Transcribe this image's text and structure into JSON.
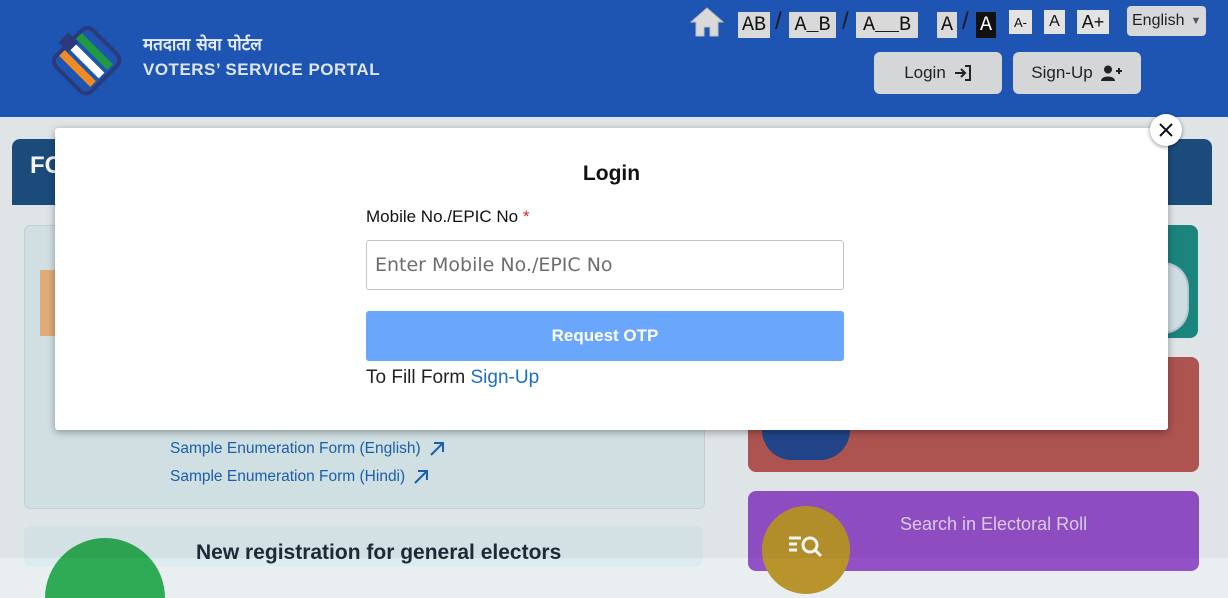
{
  "header": {
    "brand_hindi": "मतदाता सेवा पोर्टल",
    "brand_english": "VOTERS’ SERVICE PORTAL",
    "home_icon": "home-icon",
    "spacing_options": [
      "AB",
      "A_B",
      "A__B"
    ],
    "contrast_options": [
      "A",
      "A"
    ],
    "font_size_options": [
      "A-",
      "A",
      "A+"
    ],
    "language": {
      "selected": "English"
    },
    "login_label": "Login",
    "signup_label": "Sign-Up"
  },
  "background": {
    "section_title_partial": "FC",
    "links": [
      "Sample Enumeration Form (English)",
      "Sample Enumeration Form (Hindi)"
    ],
    "section_heading_partial": "New registration for general electors",
    "red_card_text_partial": "...",
    "purple_card_title": "Search in Electoral Roll",
    "purple_card_subtitle_partial": "..."
  },
  "modal": {
    "title": "Login",
    "field_label": "Mobile No./EPIC No",
    "required_mark": "*",
    "input_placeholder": "Enter Mobile No./EPIC No",
    "input_value": "",
    "submit_label": "Request OTP",
    "footer_text": "To Fill Form",
    "footer_link": "Sign-Up",
    "close_label": "X"
  },
  "colors": {
    "header_bg": "#1f55b2",
    "primary_button": "#6aa6fb",
    "link": "#1b6fc4",
    "required": "#d9262c"
  }
}
